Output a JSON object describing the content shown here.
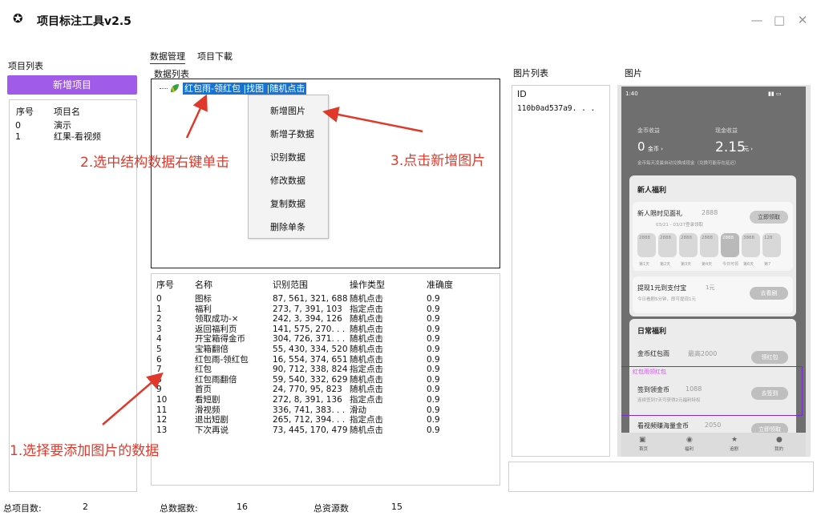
{
  "window": {
    "title": "项目标注工具v2.5",
    "minimize_glyph": "—",
    "maximize_glyph": "□",
    "close_glyph": "✕"
  },
  "projects": {
    "label": "项目列表",
    "add_button": "新增项目",
    "col_index": "序号",
    "col_name": "项目名",
    "rows": [
      {
        "index": "0",
        "name": "演示"
      },
      {
        "index": "1",
        "name": "红果-看视频"
      }
    ]
  },
  "tabs": [
    "数据管理",
    "项目下載"
  ],
  "data_list": {
    "label": "数据列表",
    "tree_node": "红包雨-领红包 |找图 |随机点击"
  },
  "context_menu": [
    "新增图片",
    "新增子数据",
    "识别数据",
    "修改数据",
    "复制数据",
    "删除单条"
  ],
  "items": {
    "headers": [
      "序号",
      "名称",
      "识别范围",
      "操作类型",
      "准确度"
    ],
    "rows": [
      [
        "0",
        "图标",
        "87, 561, 321, 688",
        "随机点击",
        "0.9"
      ],
      [
        "1",
        "福利",
        "273, 7, 391, 103",
        "指定点击",
        "0.9"
      ],
      [
        "2",
        "领取成功-×",
        "242, 3, 394, 126",
        "随机点击",
        "0.9"
      ],
      [
        "3",
        "返回福利页",
        "141, 575, 270. . .",
        "随机点击",
        "0.9"
      ],
      [
        "4",
        "开宝箱得金币",
        "304, 726, 371. . .",
        "随机点击",
        "0.9"
      ],
      [
        "5",
        "宝箱翻倍",
        "55, 430, 334, 520",
        "随机点击",
        "0.9"
      ],
      [
        "6",
        "红包雨-领红包",
        "16, 554, 374, 651",
        "随机点击",
        "0.9"
      ],
      [
        "7",
        "红包",
        "90, 712, 338, 824",
        "指定点击",
        "0.9"
      ],
      [
        "8",
        "红包雨翻倍",
        "59, 540, 332, 629",
        "随机点击",
        "0.9"
      ],
      [
        "9",
        "首页",
        "24, 770, 95, 823",
        "随机点击",
        "0.9"
      ],
      [
        "10",
        "看短剧",
        "272, 8, 391, 136",
        "指定点击",
        "0.9"
      ],
      [
        "11",
        "滑视频",
        "336, 741, 383. . .",
        "滑动",
        "0.9"
      ],
      [
        "12",
        "退出短剧",
        "265, 712, 394. . .",
        "指定点击",
        "0.9"
      ],
      [
        "13",
        "下次再说",
        "73, 445, 170, 479",
        "随机点击",
        "0.9"
      ]
    ]
  },
  "image_list": {
    "label": "图片列表",
    "col_id": "ID",
    "rows": [
      "110b0ad537a9. . ."
    ]
  },
  "preview": {
    "label": "图片",
    "phone": {
      "time": "1:40",
      "coin_income_label": "金币收益",
      "coin_value": "0",
      "coin_unit": "金币 ›",
      "cash_label": "现金收益",
      "cash_value": "2.15",
      "cash_unit": "元 ›",
      "notice": "金币每天凌晨自动兑换成现金（兑换可能存在延迟）",
      "newbie_title": "新人福利",
      "gift_title": "新人限时见面礼",
      "gift_coins": "2888",
      "gift_date": "03/21 - 03/27登录领取",
      "gift_button": "立即领取",
      "day_values": [
        "2888",
        "2888",
        "2888",
        "2888",
        "2888",
        "3888",
        "128"
      ],
      "day_labels": [
        "第1天",
        "第2天",
        "第3天",
        "第4天",
        "今日可领",
        "第6天",
        "第7"
      ],
      "alipay_title": "提现1元到支付宝",
      "alipay_amount": "1元",
      "alipay_sub": "今日看剧5分钟，即可提现1元",
      "alipay_button": "去看剧",
      "daily_title": "日常福利",
      "redpack_title": "金币红包雨",
      "redpack_amount": "最高2000",
      "redpack_button": "领红包",
      "overlay_label": "红包雨领红包",
      "signin_title": "签到领金币",
      "signin_amount": "1088",
      "signin_sub": "连续签到7天可获得2元福利特权",
      "signin_button": "去签到",
      "video_title": "看视频赚海量金币",
      "video_amount": "2050",
      "video_button": "立即领取",
      "nav": [
        "首页",
        "福利",
        "追剧",
        "我的"
      ]
    }
  },
  "status": {
    "projects_label": "总项目数:",
    "projects_value": "2",
    "data_label": "总数据数:",
    "data_value": "16",
    "resources_label": "总资源数",
    "resources_value": "15"
  },
  "annotations": {
    "step1": "1.选择要添加图片的数据",
    "step2": "2.选中结构数据右键单击",
    "step3": "3.点击新增图片",
    "color": "#e0392b"
  }
}
